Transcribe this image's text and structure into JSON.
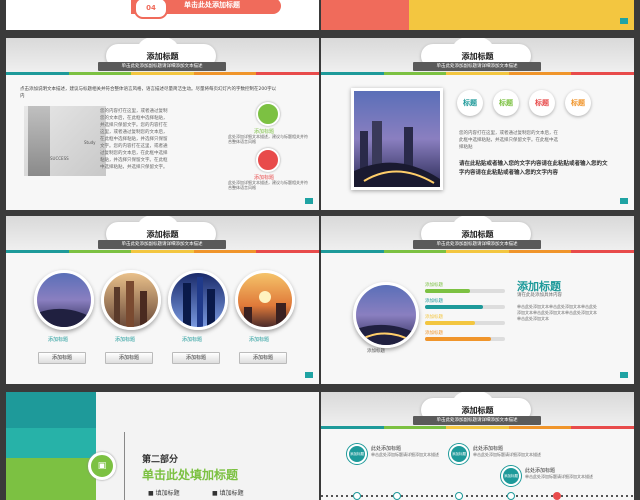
{
  "colors": {
    "teal": "#1e9a9a",
    "green": "#7cc142",
    "orange": "#f0952b",
    "red": "#e84b4b",
    "yellow": "#f3c640"
  },
  "slide_top_left": {
    "label": "04",
    "title": "单击此处添加标题"
  },
  "slide_header": {
    "title": "添加标题",
    "subtitle": "单击此处添加副标题请详细添加文本描述"
  },
  "slide2": {
    "intro": "点击添加说明文本描述，建议与标题相关并符合整体语言风格，语言描述尽量简洁生动。尽量将每页幻灯片的字数控制在200字以内",
    "tags": [
      "SUCCESS",
      "Study"
    ],
    "body": "您的内容打在这里，或者通过复制您的文本后，在此框中选择粘贴，并选择只保留文字。您的内容打在这里，或者通过复制您的文本后，在此框中选择粘贴，并选择只保留文字。您的内容打在这里，或者通过复制您的文本后，在此框中选择粘贴，并选择只保留文字。在此框中选择粘贴，并选择只保留文字。",
    "items": [
      {
        "title": "添加标题",
        "text": "此处添加详细文本描述，建议与标题相关并符合整体语言风格"
      },
      {
        "title": "添加标题",
        "text": "此处添加详细文本描述，建议与标题相关并符合整体语言风格"
      }
    ]
  },
  "slide3": {
    "pins": [
      "标题",
      "标题",
      "标题",
      "标题"
    ],
    "body": "您的内容打在这里，或者通过复制您的文本后，在此框中选择粘贴，并选择只保留文字。在此框中选择粘贴",
    "bold": "请在此粘贴或者输入您的文字内容请在此粘贴或者输入您的文字内容请在此粘贴或者输入您的文字内容"
  },
  "slide4": {
    "captions": [
      "添加标题",
      "添加标题",
      "添加标题",
      "添加标题"
    ],
    "buttons": [
      "添加标题",
      "添加标题",
      "添加标题",
      "添加标题"
    ]
  },
  "slide5": {
    "photo_caption": "添加标题",
    "bars": [
      {
        "label": "添加标题",
        "value": 0.56
      },
      {
        "label": "添加标题",
        "value": 0.72
      },
      {
        "label": "添加标题",
        "value": 0.62
      },
      {
        "label": "添加标题",
        "value": 0.82
      }
    ],
    "heading": "添加标题",
    "sub": "请在此处添加具体内容",
    "body": "单击此处添加文本单击此处添加文本单击此处添加文本单击此处添加文本单击此处添加文本单击此处添加文本"
  },
  "slide6": {
    "part": "第二部分",
    "title": "单击此处填加标题",
    "bullets": [
      "填加标题",
      "填加标题"
    ]
  },
  "slide7": {
    "nodes": [
      {
        "circle": "添加标题",
        "title": "此处添加标题",
        "text": "单击此处添加标题请详细添加文本描述"
      },
      {
        "circle": "添加标题",
        "title": "此处添加标题",
        "text": "单击此处添加标题请详细添加文本描述"
      },
      {
        "circle": "添加标题",
        "title": "此处添加标题",
        "text": "单击此处添加标题请详细添加文本描述"
      }
    ]
  }
}
